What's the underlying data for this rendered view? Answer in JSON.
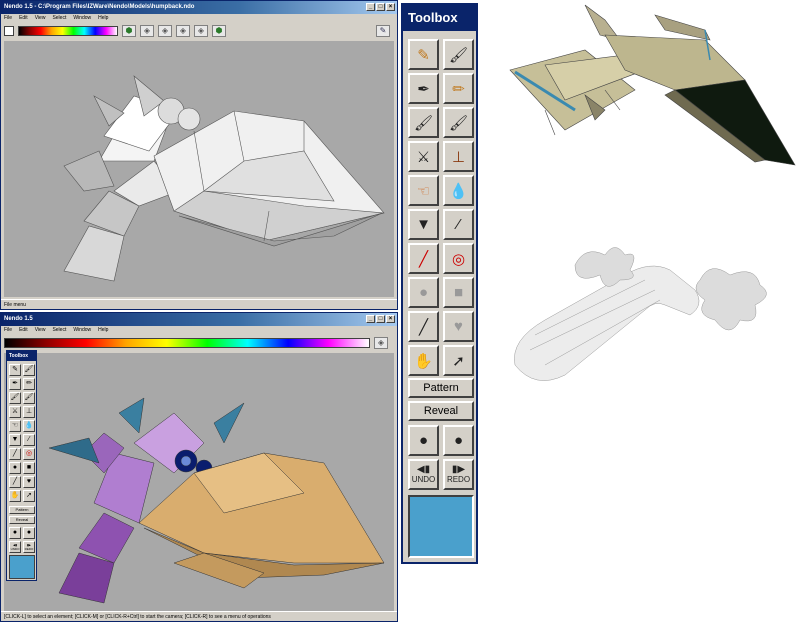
{
  "window1": {
    "title": "Nendo 1.5 - C:\\Program Files\\IZWare\\Nendo\\Models\\humpback.ndo",
    "menus": [
      "File",
      "Edit",
      "View",
      "Select",
      "Window",
      "Help"
    ],
    "status": "File menu"
  },
  "window2": {
    "title": "Nendo 1.5",
    "menus": [
      "File",
      "Edit",
      "View",
      "Select",
      "Window",
      "Help"
    ],
    "status": "[CLICK-L] to select an element; [CLICK-M] or [CLICK-R+Ctrl] to start the camera; [CLICK-R] to see a menu of operations"
  },
  "toolbox": {
    "title": "Toolbox",
    "pattern_label": "Pattern",
    "reveal_label": "Reveal",
    "undo_label": "UNDO",
    "redo_label": "REDO",
    "current_color": "#4aa0cc"
  },
  "small_toolbox": {
    "title": "Toolbox",
    "pattern_label": "Pattern",
    "reveal_label": "Reveal",
    "undo_label": "UNDO",
    "redo_label": "REDO"
  },
  "icons": [
    "pencil-icon",
    "brush-icon",
    "airbrush-icon",
    "marker-icon",
    "paint-brush-icon",
    "fine-brush-icon",
    "knife-icon",
    "stamp-icon",
    "smudge-hand-icon",
    "water-drop-icon",
    "paint-bucket-icon",
    "eyedropper-icon",
    "dynamite-icon",
    "target-icon",
    "circle-icon",
    "square-icon",
    "line-icon",
    "heart-icon",
    "grab-hand-icon",
    "arrow-cursor-icon"
  ]
}
